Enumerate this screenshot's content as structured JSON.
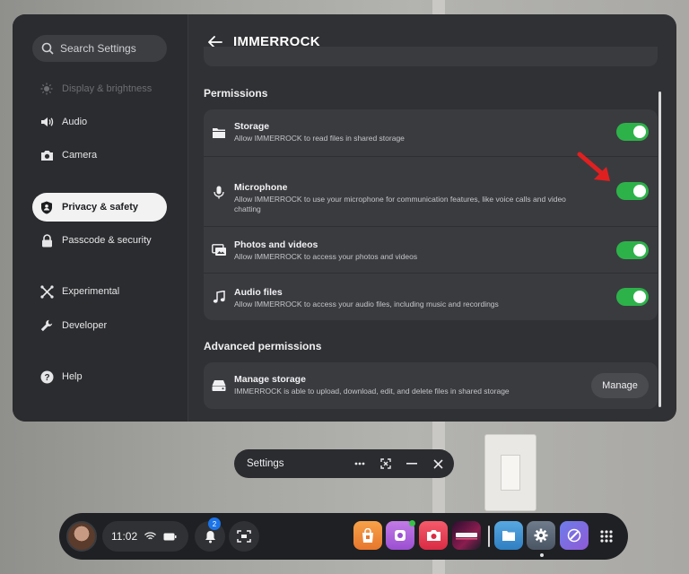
{
  "search": {
    "placeholder": "Search Settings"
  },
  "sidebar": {
    "items": [
      {
        "label": "Display & brightness",
        "icon": "sun-icon",
        "state": "disabled"
      },
      {
        "label": "Audio",
        "icon": "speaker-icon"
      },
      {
        "label": "Camera",
        "icon": "camera-icon"
      },
      {
        "label": "Privacy & safety",
        "icon": "shield-icon",
        "state": "active"
      },
      {
        "label": "Passcode & security",
        "icon": "lock-icon"
      },
      {
        "label": "Experimental",
        "icon": "experimental-icon"
      },
      {
        "label": "Developer",
        "icon": "wrench-icon"
      },
      {
        "label": "Help",
        "icon": "help-icon"
      }
    ]
  },
  "header": {
    "title": "IMMERROCK",
    "back_icon": "back-arrow-icon"
  },
  "permissions": {
    "section_title": "Permissions",
    "items": [
      {
        "title": "Storage",
        "desc": "Allow IMMERROCK to read files in shared storage",
        "icon": "folder-icon",
        "enabled": true
      },
      {
        "title": "Microphone",
        "desc": "Allow IMMERROCK to use your microphone for communication features, like voice calls and video chatting",
        "icon": "microphone-icon",
        "enabled": true
      },
      {
        "title": "Photos and videos",
        "desc": "Allow IMMERROCK to access your photos and videos",
        "icon": "photos-icon",
        "enabled": true
      },
      {
        "title": "Audio files",
        "desc": "Allow IMMERROCK to access your audio files, including music and recordings",
        "icon": "music-note-icon",
        "enabled": true
      }
    ]
  },
  "advanced": {
    "section_title": "Advanced permissions",
    "items": [
      {
        "title": "Manage storage",
        "desc": "IMMERROCK is able to upload, download, edit, and delete files in shared storage",
        "icon": "drive-icon",
        "button": "Manage"
      }
    ]
  },
  "window_bar": {
    "title": "Settings"
  },
  "dock": {
    "time": "11:02",
    "notification_count": "2",
    "apps": [
      "store-app",
      "assistant-app",
      "camera-app",
      "immerrock-app",
      "files-app",
      "settings-app",
      "browser-app"
    ]
  },
  "colors": {
    "toggle_on": "#2db24a",
    "panel_bg": "#303134",
    "annotation_arrow": "#e02020",
    "badge": "#1b73e8"
  }
}
